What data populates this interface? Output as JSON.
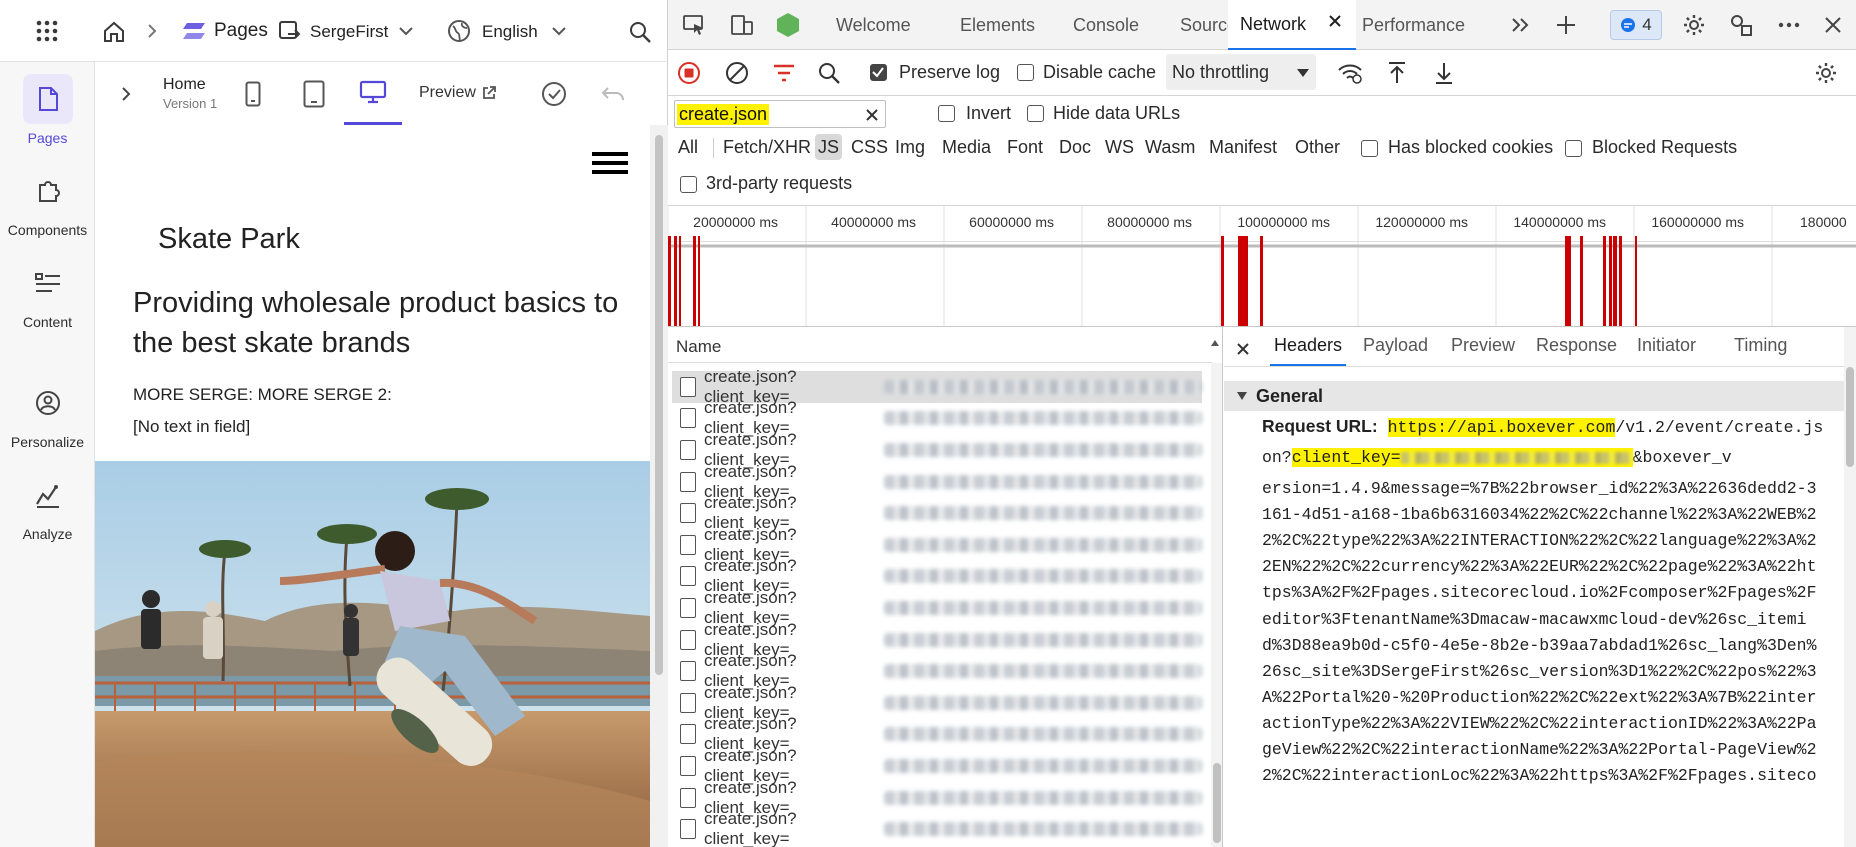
{
  "app": {
    "breadcrumb": {
      "pages_label": "Pages",
      "site_label": "SergeFirst",
      "language_label": "English"
    },
    "rail": [
      {
        "label": "Pages",
        "icon": "page-icon"
      },
      {
        "label": "Components",
        "icon": "puzzle-icon"
      },
      {
        "label": "Content",
        "icon": "list-icon"
      },
      {
        "label": "Personalize",
        "icon": "target-icon"
      },
      {
        "label": "Analyze",
        "icon": "chart-icon"
      }
    ],
    "editor": {
      "page_name": "Home",
      "version": "Version 1",
      "preview_label": "Preview"
    },
    "canvas": {
      "site_title": "Skate Park",
      "headline": "Providing wholesale product basics to the best skate brands",
      "more_text": "MORE SERGE: MORE SERGE 2:",
      "empty_field": "[No text in field]"
    }
  },
  "devtools": {
    "tabs": [
      "Welcome",
      "Elements",
      "Console",
      "Sources",
      "Network",
      "Performance"
    ],
    "active_tab": "Network",
    "issues_count": "4",
    "toolbar": {
      "preserve_log": "Preserve log",
      "disable_cache": "Disable cache",
      "throttling": "No throttling"
    },
    "filter": {
      "value": "create.json",
      "invert": "Invert",
      "hide_data_urls": "Hide data URLs",
      "types": [
        "All",
        "Fetch/XHR",
        "JS",
        "CSS",
        "Img",
        "Media",
        "Font",
        "Doc",
        "WS",
        "Wasm",
        "Manifest",
        "Other"
      ],
      "active_type": "JS",
      "has_blocked_cookies": "Has blocked cookies",
      "blocked_requests": "Blocked Requests",
      "third_party": "3rd-party requests"
    },
    "timeline_ticks": [
      "20000000 ms",
      "40000000 ms",
      "60000000 ms",
      "80000000 ms",
      "100000000 ms",
      "120000000 ms",
      "140000000 ms",
      "160000000 ms",
      "180000"
    ],
    "list": {
      "header": "Name",
      "rows": [
        "create.json?client_key=",
        "create.json?client_key=",
        "create.json?client_key=",
        "create.json?client_key=",
        "create.json?client_key=",
        "create.json?client_key=",
        "create.json?client_key=",
        "create.json?client_key=",
        "create.json?client_key=",
        "create.json?client_key=",
        "create.json?client_key=",
        "create.json?client_key=",
        "create.json?client_key=",
        "create.json?client_key=",
        "create.json?client_key="
      ]
    },
    "detail": {
      "tabs": [
        "Headers",
        "Payload",
        "Preview",
        "Response",
        "Initiator",
        "Timing"
      ],
      "active_tab": "Headers",
      "section": "General",
      "request_url_label": "Request URL:",
      "url_host": "https://api.boxever.com",
      "url_path1": "/v1.2/event/create.js",
      "url_line2_a": "on?",
      "url_key_label": "client_key=",
      "url_line2_b": "&boxever_v",
      "url_lines": [
        "ersion=1.4.9&message=%7B%22browser_id%22%3A%22636dedd2-3",
        "161-4d51-a168-1ba6b6316034%22%2C%22channel%22%3A%22WEB%2",
        "2%2C%22type%22%3A%22INTERACTION%22%2C%22language%22%3A%2",
        "2EN%22%2C%22currency%22%3A%22EUR%22%2C%22page%22%3A%22ht",
        "tps%3A%2F%2Fpages.sitecorecloud.io%2Fcomposer%2Fpages%2F",
        "editor%3FtenantName%3Dmacaw-macawxmcloud-dev%26sc_itemi",
        "d%3D88ea9b0d-c5f0-4e5e-8b2e-b39aa7abdad1%26sc_lang%3Den%",
        "26sc_site%3DSergeFirst%26sc_version%3D1%22%2C%22pos%22%3",
        "A%22Portal%20-%20Production%22%2C%22ext%22%3A%7B%22inter",
        "actionType%22%3A%22VIEW%22%2C%22interactionID%22%3A%22Pa",
        "geView%22%2C%22interactionName%22%3A%22Portal-PageView%2",
        "2%2C%22interactionLoc%22%3A%22https%3A%2F%2Fpages.siteco"
      ]
    }
  }
}
